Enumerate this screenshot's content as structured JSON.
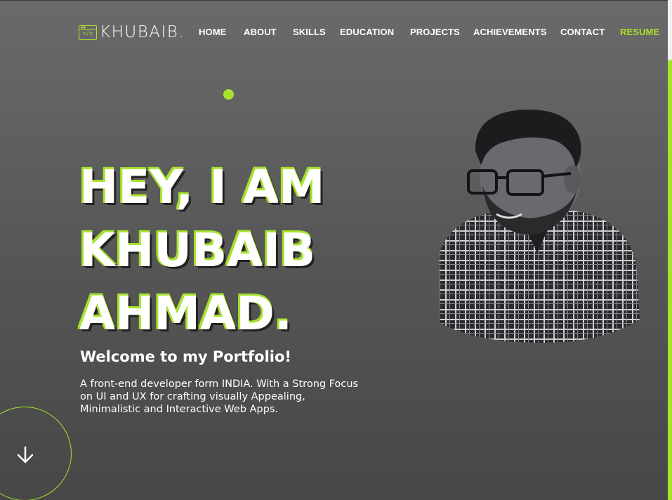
{
  "header": {
    "logo_code": "</>",
    "logo_text": "KHUBAIB.",
    "nav": [
      "HOME",
      "ABOUT",
      "SKILLS",
      "EDUCATION",
      "PROJECTS",
      "ACHIEVEMENTS",
      "CONTACT"
    ],
    "resume_label": "RESUME"
  },
  "hero": {
    "title_lines": [
      "HEY, I AM",
      "KHUBAIB",
      "AHMAD."
    ],
    "welcome": "Welcome to my Portfolio!",
    "description": "A front-end developer form INDIA. With a Strong Focus on UI and UX for crafting visually Appealing, Minimalistic and Interactive Web Apps."
  },
  "icons": {
    "scroll_down": "arrow-down-icon",
    "logo": "code-window-icon"
  },
  "colors": {
    "accent": "#a6e22e",
    "background_top": "#6a6a6a",
    "background_bottom": "#474747",
    "text": "#ffffff"
  }
}
